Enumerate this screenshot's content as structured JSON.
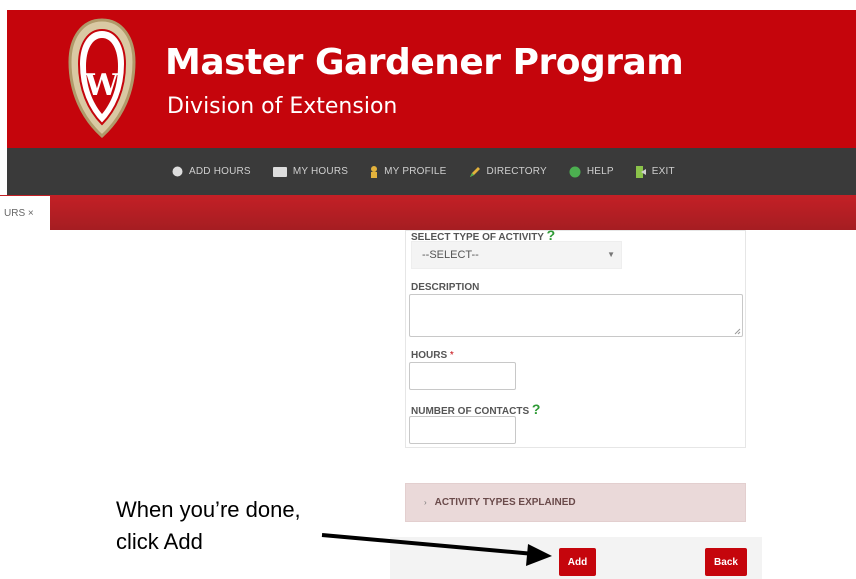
{
  "header": {
    "title": "Master Gardener Program",
    "subtitle": "Division of Extension",
    "crest_letter": "W"
  },
  "nav": {
    "items": [
      {
        "label": "ADD HOURS",
        "icon": "plus-circle-icon"
      },
      {
        "label": "MY HOURS",
        "icon": "list-icon"
      },
      {
        "label": "MY PROFILE",
        "icon": "person-icon"
      },
      {
        "label": "DIRECTORY",
        "icon": "pencil-icon"
      },
      {
        "label": "HELP",
        "icon": "help-circle-icon"
      },
      {
        "label": "EXIT",
        "icon": "exit-icon"
      }
    ]
  },
  "tab": {
    "fragment": "URS ×"
  },
  "form": {
    "activity_label": "SELECT TYPE OF ACTIVITY",
    "activity_help": "?",
    "activity_value": "--SELECT--",
    "description_label": "DESCRIPTION",
    "hours_label": "HOURS",
    "hours_required": "*",
    "contacts_label": "NUMBER OF CONTACTS",
    "contacts_help": "?"
  },
  "accordion": {
    "label": "ACTIVITY TYPES EXPLAINED"
  },
  "buttons": {
    "add": "Add",
    "back": "Back"
  },
  "annotation": {
    "text": "When you’re done, click Add"
  },
  "colors": {
    "brand_red": "#c5050c",
    "nav_dark": "#3a3a3a",
    "help_green": "#2e9a35"
  }
}
